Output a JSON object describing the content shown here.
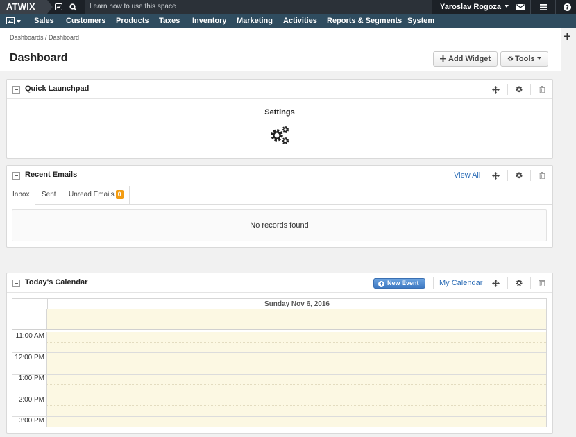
{
  "topbar": {
    "logo": "ATWIX",
    "search_hint": "Learn how to use this space",
    "user_name": "Yaroslav Rogoza"
  },
  "nav": {
    "items": [
      "Sales",
      "Customers",
      "Products",
      "Taxes",
      "Inventory",
      "Marketing",
      "Activities",
      "Reports & Segments",
      "System"
    ]
  },
  "page": {
    "breadcrumb": "Dashboards / Dashboard",
    "title": "Dashboard",
    "add_widget_label": "Add Widget",
    "tools_label": "Tools"
  },
  "widgets": {
    "launchpad": {
      "title": "Quick Launchpad",
      "item_label": "Settings"
    },
    "emails": {
      "title": "Recent Emails",
      "view_all": "View All",
      "tabs": [
        "Inbox",
        "Sent",
        "Unread Emails"
      ],
      "unread_count": "0",
      "empty_text": "No records found"
    },
    "calendar": {
      "title": "Today's Calendar",
      "new_event_label": "New Event",
      "my_calendar_label": "My Calendar",
      "date_header": "Sunday Nov 6, 2016",
      "times": [
        "11:00 AM",
        "12:00 PM",
        "1:00 PM",
        "2:00 PM",
        "3:00 PM"
      ]
    }
  },
  "colors": {
    "topbar": "#1c2127",
    "navbar": "#2f4c5f",
    "link": "#2a6bb5",
    "badge": "#f39c12",
    "calendar_day_bg": "#fcf8e3",
    "now_line": "#e03a3a"
  },
  "icons": [
    "image-icon",
    "chart-icon",
    "search-icon",
    "envelope-icon",
    "menu-icon",
    "help-icon",
    "plus-icon",
    "move-icon",
    "gear-icon",
    "trash-icon",
    "gears-icon"
  ]
}
